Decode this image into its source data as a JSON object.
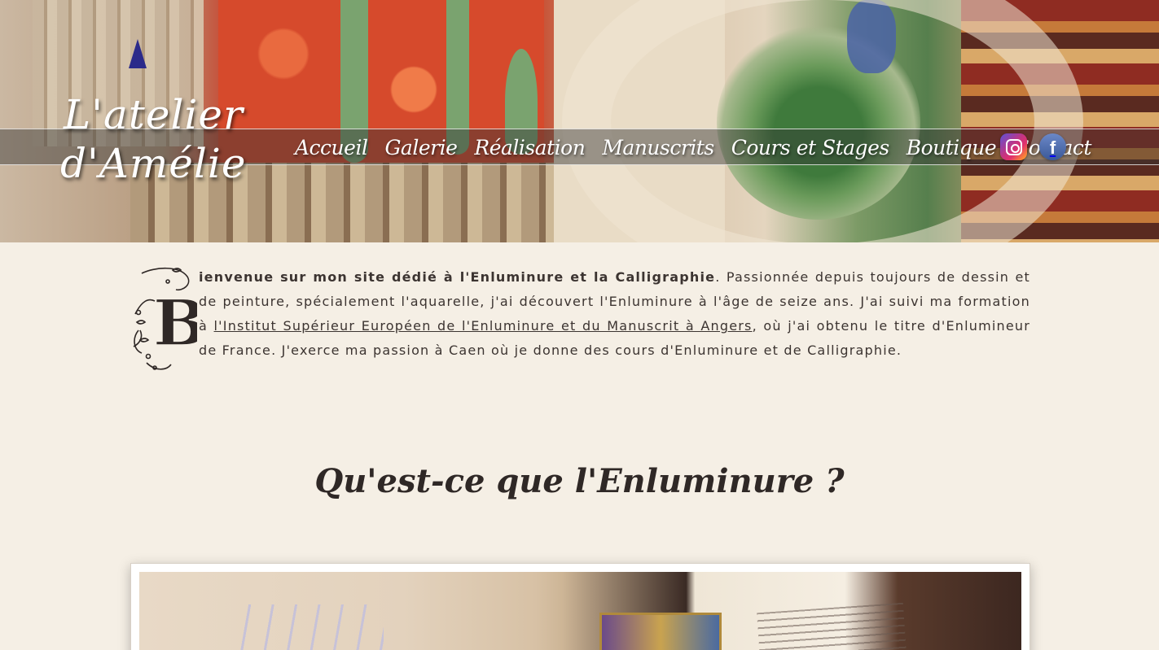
{
  "site": {
    "logo_line1": "L'atelier",
    "logo_line2": "d'Amélie"
  },
  "nav": {
    "items": [
      {
        "label": "Accueil"
      },
      {
        "label": "Galerie"
      },
      {
        "label": "Réalisation"
      },
      {
        "label": "Manuscrits"
      },
      {
        "label": "Cours et Stages"
      },
      {
        "label": "Boutique"
      },
      {
        "label": "Contact"
      }
    ],
    "social": [
      {
        "icon": "instagram-icon"
      },
      {
        "icon": "facebook-icon",
        "glyph": "f"
      }
    ]
  },
  "intro": {
    "dropcap": "B",
    "lead": "ienvenue sur mon site dédié à l'Enluminure et la Calligraphie",
    "text1": ". Passionnée depuis toujours de dessin et de peinture, spécialement l'aquarelle, j'ai découvert l'Enluminure à l'âge de seize ans. J'ai suivi ma formation à ",
    "link": "l'Institut Supérieur Européen de l'Enluminure et du Manuscrit à Angers",
    "text2": ", où j'ai obtenu le titre d'Enlumineur de France. J'exerce ma passion à Caen où je donne des cours d'Enluminure et de Calligraphie."
  },
  "section": {
    "title": "Qu'est-ce que l'Enluminure ?"
  },
  "colors": {
    "background": "#f5efe5",
    "text": "#3c3431",
    "nav_text": "#ffffff"
  }
}
